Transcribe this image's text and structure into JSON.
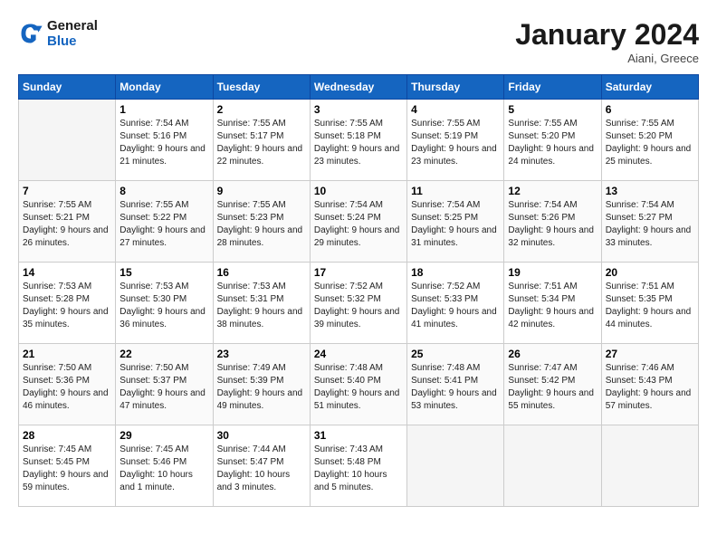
{
  "header": {
    "logo_line1": "General",
    "logo_line2": "Blue",
    "month_title": "January 2024",
    "location": "Aiani, Greece"
  },
  "days_of_week": [
    "Sunday",
    "Monday",
    "Tuesday",
    "Wednesday",
    "Thursday",
    "Friday",
    "Saturday"
  ],
  "weeks": [
    [
      {
        "day": null
      },
      {
        "day": "1",
        "sunrise": "7:54 AM",
        "sunset": "5:16 PM",
        "daylight": "9 hours and 21 minutes."
      },
      {
        "day": "2",
        "sunrise": "7:55 AM",
        "sunset": "5:17 PM",
        "daylight": "9 hours and 22 minutes."
      },
      {
        "day": "3",
        "sunrise": "7:55 AM",
        "sunset": "5:18 PM",
        "daylight": "9 hours and 23 minutes."
      },
      {
        "day": "4",
        "sunrise": "7:55 AM",
        "sunset": "5:19 PM",
        "daylight": "9 hours and 23 minutes."
      },
      {
        "day": "5",
        "sunrise": "7:55 AM",
        "sunset": "5:20 PM",
        "daylight": "9 hours and 24 minutes."
      },
      {
        "day": "6",
        "sunrise": "7:55 AM",
        "sunset": "5:20 PM",
        "daylight": "9 hours and 25 minutes."
      }
    ],
    [
      {
        "day": "7",
        "sunrise": "7:55 AM",
        "sunset": "5:21 PM",
        "daylight": "9 hours and 26 minutes."
      },
      {
        "day": "8",
        "sunrise": "7:55 AM",
        "sunset": "5:22 PM",
        "daylight": "9 hours and 27 minutes."
      },
      {
        "day": "9",
        "sunrise": "7:55 AM",
        "sunset": "5:23 PM",
        "daylight": "9 hours and 28 minutes."
      },
      {
        "day": "10",
        "sunrise": "7:54 AM",
        "sunset": "5:24 PM",
        "daylight": "9 hours and 29 minutes."
      },
      {
        "day": "11",
        "sunrise": "7:54 AM",
        "sunset": "5:25 PM",
        "daylight": "9 hours and 31 minutes."
      },
      {
        "day": "12",
        "sunrise": "7:54 AM",
        "sunset": "5:26 PM",
        "daylight": "9 hours and 32 minutes."
      },
      {
        "day": "13",
        "sunrise": "7:54 AM",
        "sunset": "5:27 PM",
        "daylight": "9 hours and 33 minutes."
      }
    ],
    [
      {
        "day": "14",
        "sunrise": "7:53 AM",
        "sunset": "5:28 PM",
        "daylight": "9 hours and 35 minutes."
      },
      {
        "day": "15",
        "sunrise": "7:53 AM",
        "sunset": "5:30 PM",
        "daylight": "9 hours and 36 minutes."
      },
      {
        "day": "16",
        "sunrise": "7:53 AM",
        "sunset": "5:31 PM",
        "daylight": "9 hours and 38 minutes."
      },
      {
        "day": "17",
        "sunrise": "7:52 AM",
        "sunset": "5:32 PM",
        "daylight": "9 hours and 39 minutes."
      },
      {
        "day": "18",
        "sunrise": "7:52 AM",
        "sunset": "5:33 PM",
        "daylight": "9 hours and 41 minutes."
      },
      {
        "day": "19",
        "sunrise": "7:51 AM",
        "sunset": "5:34 PM",
        "daylight": "9 hours and 42 minutes."
      },
      {
        "day": "20",
        "sunrise": "7:51 AM",
        "sunset": "5:35 PM",
        "daylight": "9 hours and 44 minutes."
      }
    ],
    [
      {
        "day": "21",
        "sunrise": "7:50 AM",
        "sunset": "5:36 PM",
        "daylight": "9 hours and 46 minutes."
      },
      {
        "day": "22",
        "sunrise": "7:50 AM",
        "sunset": "5:37 PM",
        "daylight": "9 hours and 47 minutes."
      },
      {
        "day": "23",
        "sunrise": "7:49 AM",
        "sunset": "5:39 PM",
        "daylight": "9 hours and 49 minutes."
      },
      {
        "day": "24",
        "sunrise": "7:48 AM",
        "sunset": "5:40 PM",
        "daylight": "9 hours and 51 minutes."
      },
      {
        "day": "25",
        "sunrise": "7:48 AM",
        "sunset": "5:41 PM",
        "daylight": "9 hours and 53 minutes."
      },
      {
        "day": "26",
        "sunrise": "7:47 AM",
        "sunset": "5:42 PM",
        "daylight": "9 hours and 55 minutes."
      },
      {
        "day": "27",
        "sunrise": "7:46 AM",
        "sunset": "5:43 PM",
        "daylight": "9 hours and 57 minutes."
      }
    ],
    [
      {
        "day": "28",
        "sunrise": "7:45 AM",
        "sunset": "5:45 PM",
        "daylight": "9 hours and 59 minutes."
      },
      {
        "day": "29",
        "sunrise": "7:45 AM",
        "sunset": "5:46 PM",
        "daylight": "10 hours and 1 minute."
      },
      {
        "day": "30",
        "sunrise": "7:44 AM",
        "sunset": "5:47 PM",
        "daylight": "10 hours and 3 minutes."
      },
      {
        "day": "31",
        "sunrise": "7:43 AM",
        "sunset": "5:48 PM",
        "daylight": "10 hours and 5 minutes."
      },
      {
        "day": null
      },
      {
        "day": null
      },
      {
        "day": null
      }
    ]
  ]
}
